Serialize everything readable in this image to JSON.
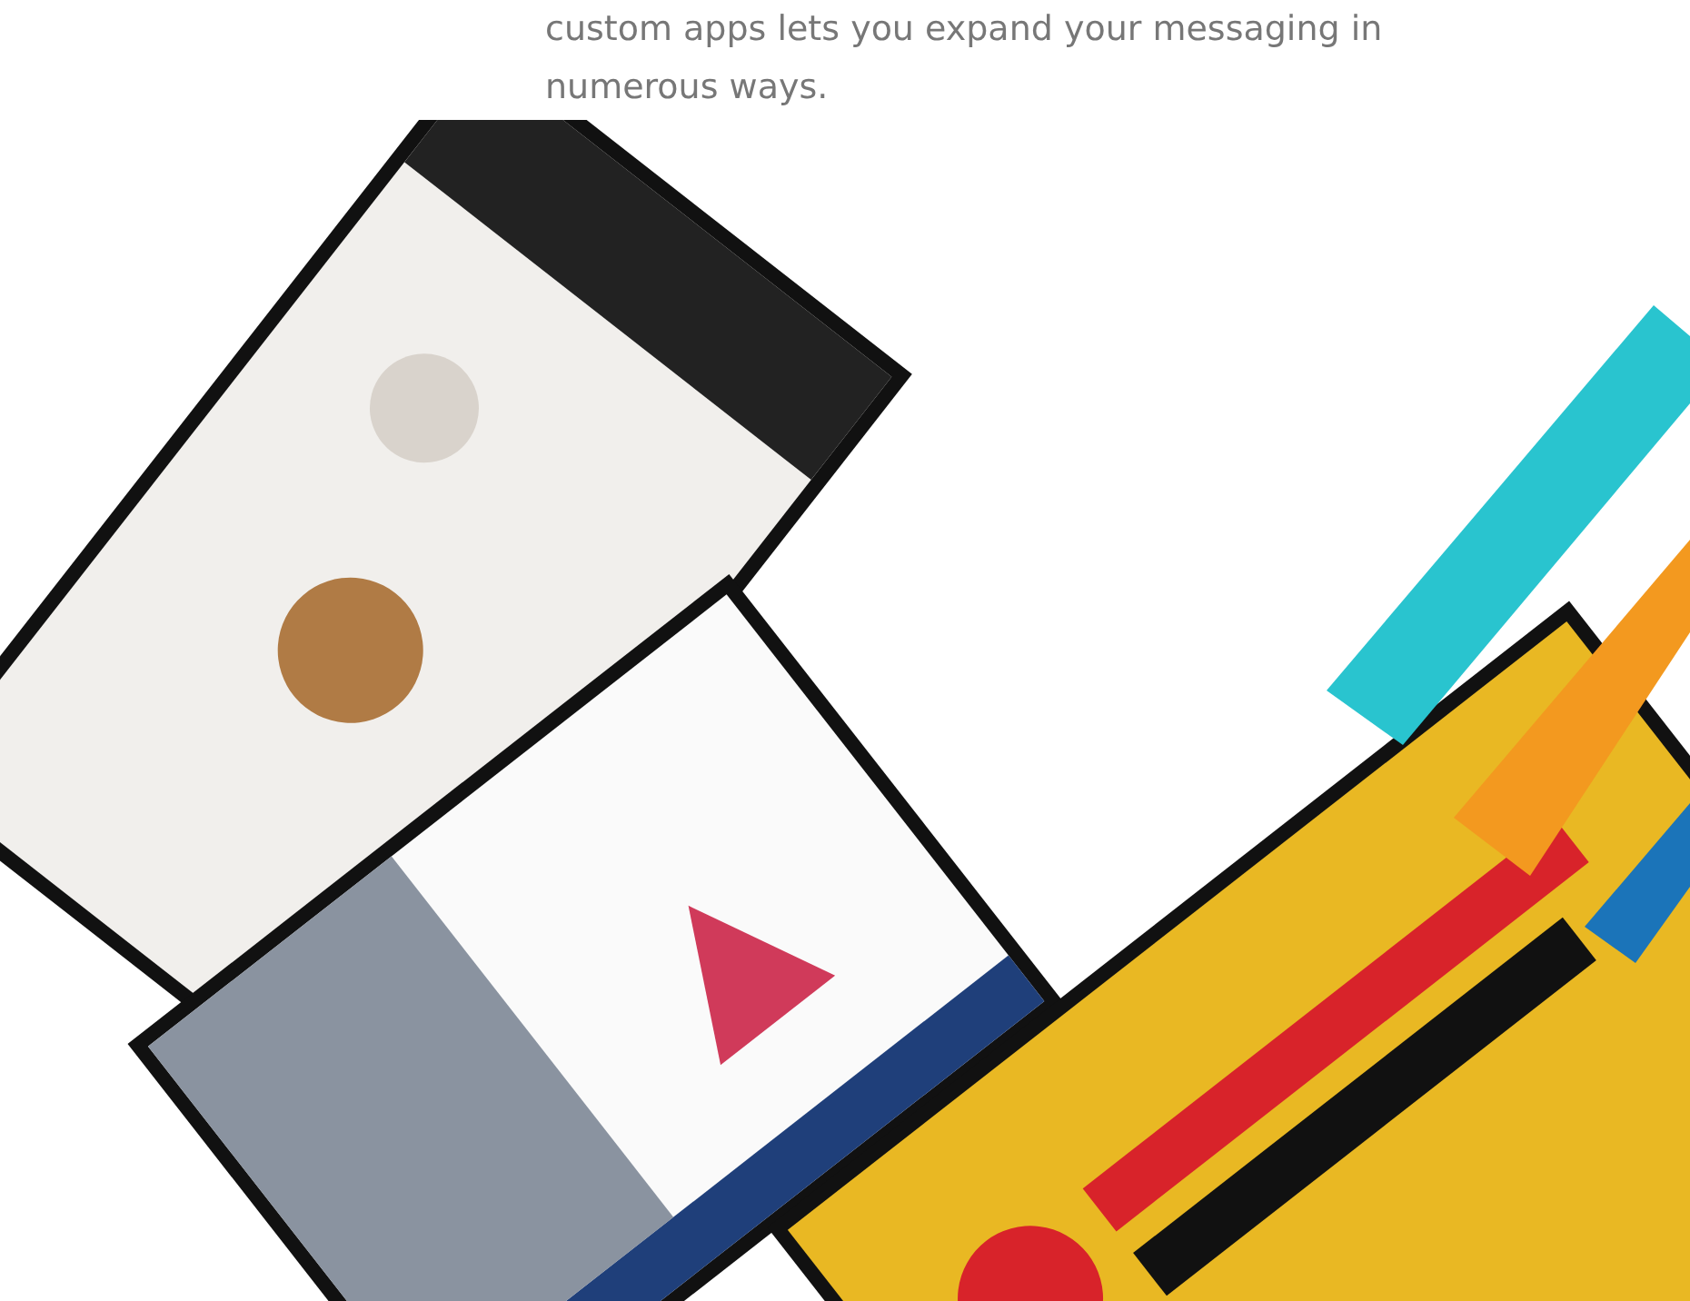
{
  "intro": {
    "text": "custom apps lets you expand your messaging in numerous ways."
  }
}
